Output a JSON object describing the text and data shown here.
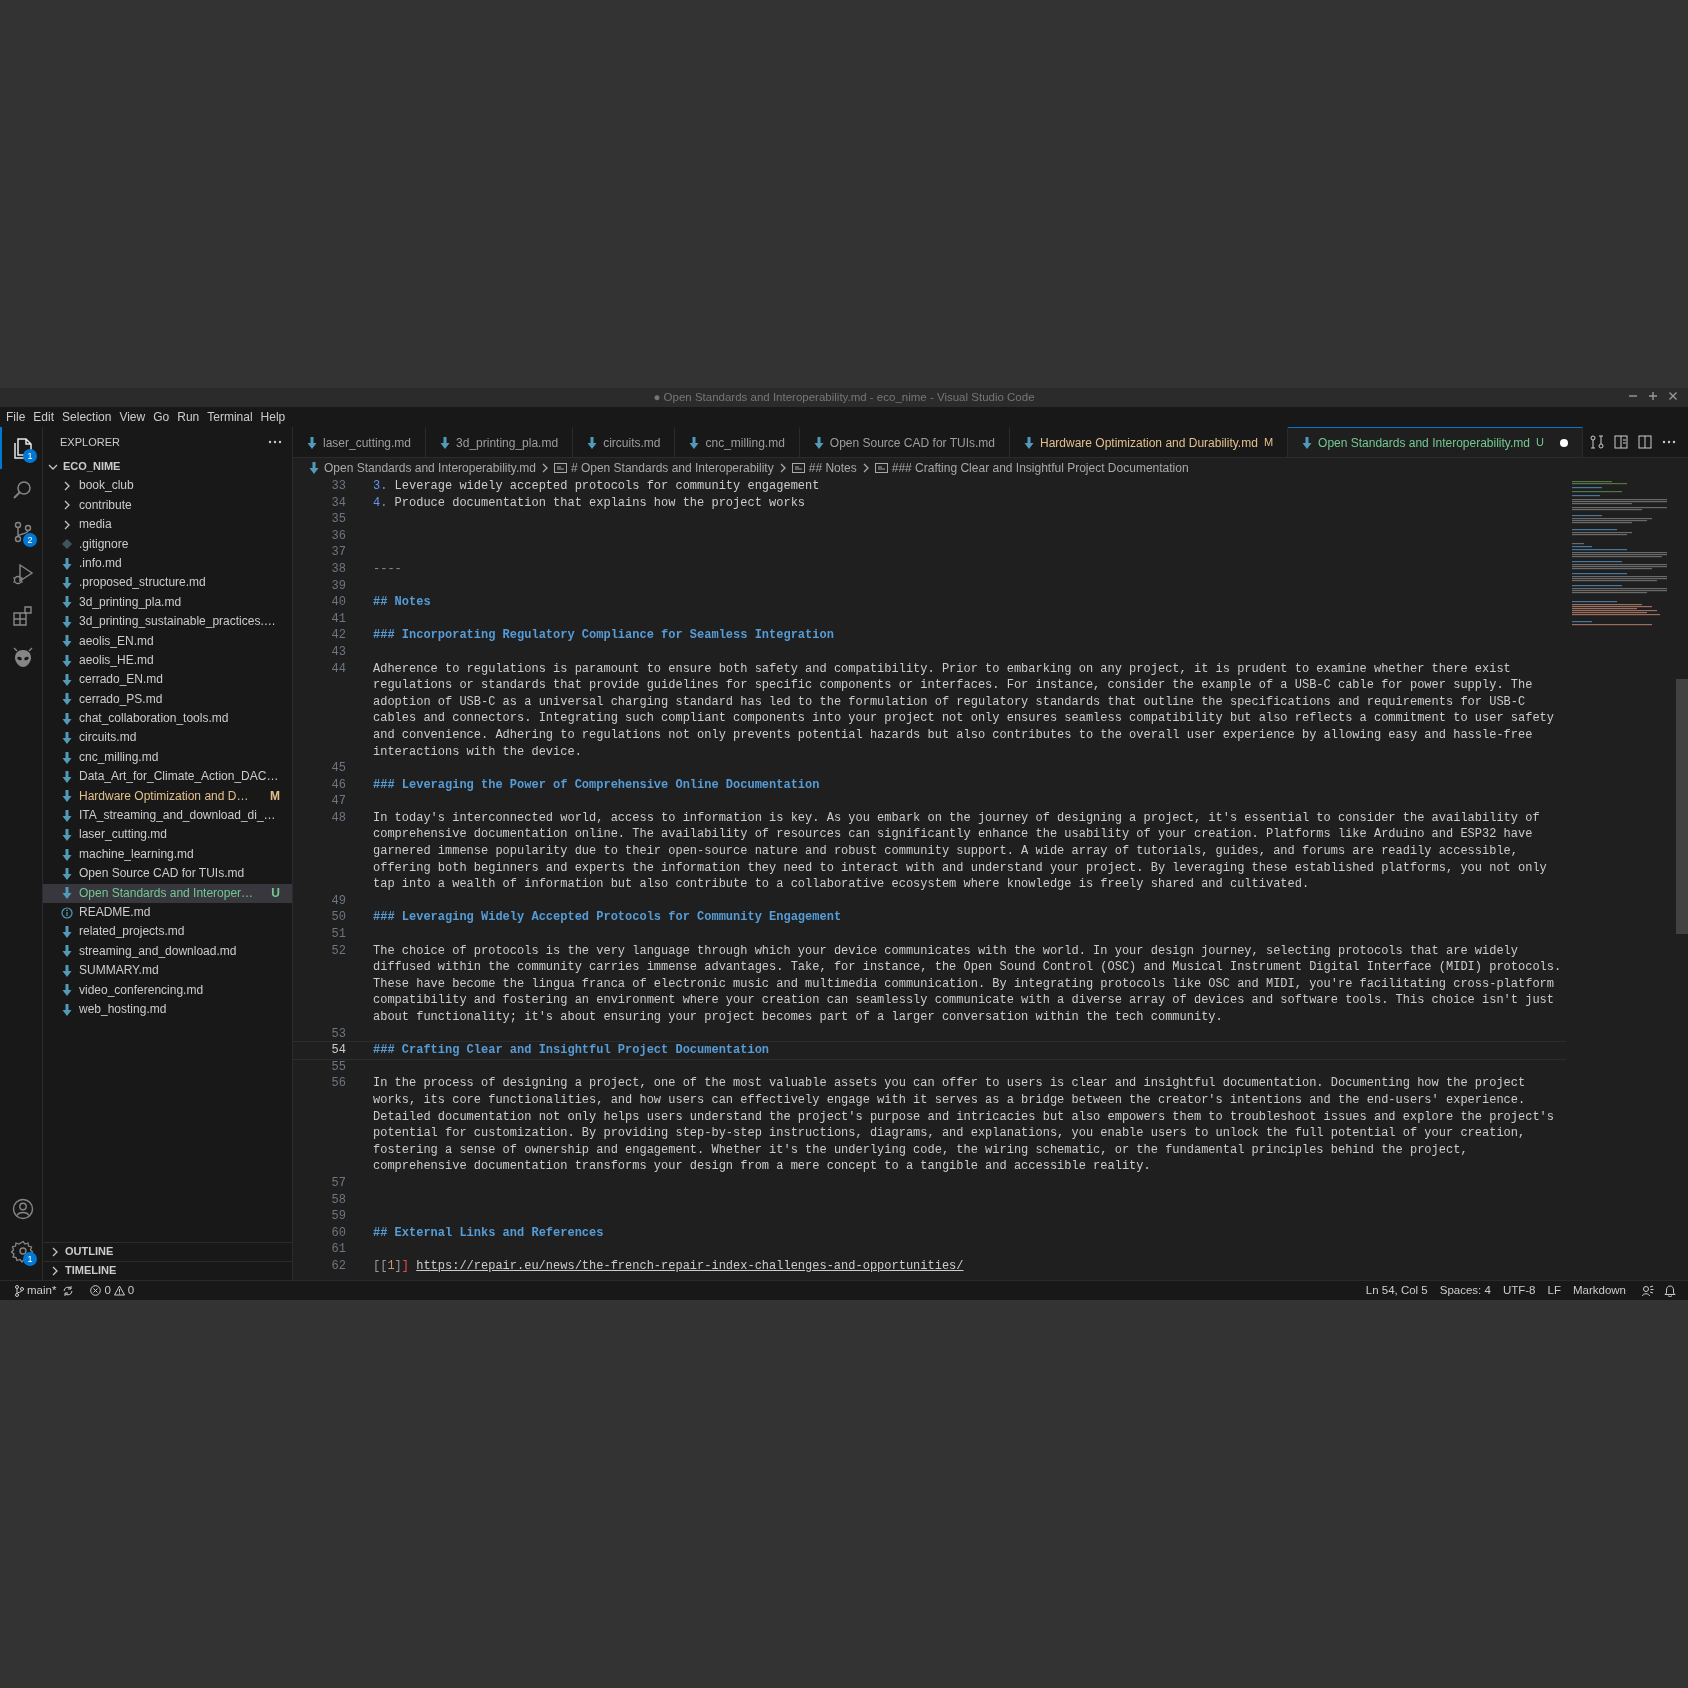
{
  "window": {
    "title": "● Open Standards and Interoperability.md - eco_nime - Visual Studio Code"
  },
  "menu": [
    "File",
    "Edit",
    "Selection",
    "View",
    "Go",
    "Run",
    "Terminal",
    "Help"
  ],
  "activity_bar": [
    {
      "selected": true,
      "badge": "1"
    },
    {
      "selected": false
    },
    {
      "selected": false,
      "badge": "2"
    },
    {
      "selected": false
    },
    {
      "selected": false
    },
    {
      "selected": false
    }
  ],
  "activity_bottom": [
    {
      "selected": false
    },
    {
      "selected": false,
      "badge": "1"
    }
  ],
  "sidebar": {
    "title": "EXPLORER",
    "root": {
      "label": "ECO_NIME",
      "expanded": true
    },
    "items": [
      {
        "label": "book_club",
        "kind": "folder",
        "expanded": false,
        "selected": false
      },
      {
        "label": "contribute",
        "kind": "folder",
        "expanded": false,
        "selected": false
      },
      {
        "label": "media",
        "kind": "folder",
        "expanded": false,
        "selected": false
      },
      {
        "label": ".gitignore",
        "kind": "gitignore",
        "selected": false
      },
      {
        "label": ".info.md",
        "kind": "markdown",
        "selected": false
      },
      {
        "label": ".proposed_structure.md",
        "kind": "markdown",
        "selected": false
      },
      {
        "label": "3d_printing_pla.md",
        "kind": "markdown",
        "selected": false
      },
      {
        "label": "3d_printing_sustainable_practices.…",
        "kind": "markdown",
        "selected": false
      },
      {
        "label": "aeolis_EN.md",
        "kind": "markdown",
        "selected": false
      },
      {
        "label": "aeolis_HE.md",
        "kind": "markdown",
        "selected": false
      },
      {
        "label": "cerrado_EN.md",
        "kind": "markdown",
        "selected": false
      },
      {
        "label": "cerrado_PS.md",
        "kind": "markdown",
        "selected": false
      },
      {
        "label": "chat_collaboration_tools.md",
        "kind": "markdown",
        "selected": false
      },
      {
        "label": "circuits.md",
        "kind": "markdown",
        "selected": false
      },
      {
        "label": "cnc_milling.md",
        "kind": "markdown",
        "selected": false
      },
      {
        "label": "Data_Art_for_Climate_Action_DAC…",
        "kind": "markdown",
        "selected": false
      },
      {
        "label": "Hardware Optimization and D…",
        "kind": "markdown",
        "selected": false,
        "status": "M",
        "color": "#e2c08d"
      },
      {
        "label": "ITA_streaming_and_download_di_…",
        "kind": "markdown",
        "selected": false
      },
      {
        "label": "laser_cutting.md",
        "kind": "markdown",
        "selected": false
      },
      {
        "label": "machine_learning.md",
        "kind": "markdown",
        "selected": false
      },
      {
        "label": "Open Source CAD for TUIs.md",
        "kind": "markdown",
        "selected": false
      },
      {
        "label": "Open Standards and Interoper…",
        "kind": "markdown",
        "selected": true,
        "status": "U",
        "color": "#73c991"
      },
      {
        "label": "README.md",
        "kind": "info",
        "selected": false
      },
      {
        "label": "related_projects.md",
        "kind": "markdown",
        "selected": false
      },
      {
        "label": "streaming_and_download.md",
        "kind": "markdown",
        "selected": false
      },
      {
        "label": "SUMMARY.md",
        "kind": "markdown",
        "selected": false
      },
      {
        "label": "video_conferencing.md",
        "kind": "markdown",
        "selected": false
      },
      {
        "label": "web_hosting.md",
        "kind": "markdown",
        "selected": false
      }
    ],
    "sections": [
      {
        "label": "OUTLINE",
        "expanded": false
      },
      {
        "label": "TIMELINE",
        "expanded": false
      }
    ]
  },
  "tabs": [
    {
      "label": "laser_cutting.md",
      "selected": false,
      "dirty": false
    },
    {
      "label": "3d_printing_pla.md",
      "selected": false,
      "dirty": false
    },
    {
      "label": "circuits.md",
      "selected": false,
      "dirty": false
    },
    {
      "label": "cnc_milling.md",
      "selected": false,
      "dirty": false
    },
    {
      "label": "Open Source CAD for TUIs.md",
      "selected": false,
      "dirty": false
    },
    {
      "label": "Hardware Optimization and Durability.md",
      "selected": false,
      "dirty": false,
      "status": "M",
      "color": "#e2c08d"
    },
    {
      "label": "Open Standards and Interoperability.md",
      "selected": true,
      "dirty": true,
      "status": "U",
      "color": "#73c991"
    }
  ],
  "breadcrumbs": [
    {
      "label": "Open Standards and Interoperability.md",
      "kind": "file"
    },
    {
      "label": "# Open Standards and Interoperability",
      "kind": "symbol"
    },
    {
      "label": "## Notes",
      "kind": "symbol"
    },
    {
      "label": "### Crafting Clear and Insightful Project Documentation",
      "kind": "symbol"
    }
  ],
  "lines": [
    {
      "number": "33",
      "kind": "list",
      "marker": "3.",
      "text": "Leverage widely accepted protocols for community engagement",
      "current": false
    },
    {
      "number": "34",
      "kind": "list",
      "marker": "4.",
      "text": "Produce documentation that explains how the project works",
      "current": false
    },
    {
      "number": "35",
      "current": false
    },
    {
      "number": "36",
      "current": false
    },
    {
      "number": "37",
      "current": false
    },
    {
      "number": "38",
      "kind": "rule",
      "text": "----",
      "current": false
    },
    {
      "number": "39",
      "current": false
    },
    {
      "number": "40",
      "kind": "heading",
      "text": "## Notes",
      "current": false
    },
    {
      "number": "41",
      "current": false
    },
    {
      "number": "42",
      "kind": "heading",
      "text": "### Incorporating Regulatory Compliance for Seamless Integration",
      "current": false
    },
    {
      "number": "43",
      "current": false
    },
    {
      "number": "44",
      "kind": "text",
      "text": "Adherence to regulations is paramount to ensure both safety and compatibility. Prior to embarking on any project, it is prudent to examine whether there exist regulations or standards that provide guidelines for specific components or interfaces. For instance, consider the example of a USB-C cable for power supply. The adoption of USB-C as a universal charging standard has led to the formulation of regulatory standards that outline the specifications and requirements for USB-C cables and connectors. Integrating such compliant components into your project not only ensures seamless compatibility but also reflects a commitment to user safety and convenience. Adhering to regulations not only prevents potential hazards but also contributes to the overall user experience by allowing easy and hassle-free interactions with the device.",
      "current": false
    },
    {
      "number": "45",
      "current": false
    },
    {
      "number": "46",
      "kind": "heading",
      "text": "### Leveraging the Power of Comprehensive Online Documentation",
      "current": false
    },
    {
      "number": "47",
      "current": false
    },
    {
      "number": "48",
      "kind": "text",
      "text": "In today's interconnected world, access to information is key. As you embark on the journey of designing a project, it's essential to consider the availability of comprehensive documentation online. The availability of resources can significantly enhance the usability of your creation. Platforms like Arduino and ESP32 have garnered immense popularity due to their open-source nature and robust community support. A wide array of tutorials, guides, and forums are readily accessible, offering both beginners and experts the information they need to interact with and understand your project. By leveraging these established platforms, you not only tap into a wealth of information but also contribute to a collaborative ecosystem where knowledge is freely shared and cultivated.",
      "current": false
    },
    {
      "number": "49",
      "current": false
    },
    {
      "number": "50",
      "kind": "heading",
      "text": "### Leveraging Widely Accepted Protocols for Community Engagement",
      "current": false
    },
    {
      "number": "51",
      "current": false
    },
    {
      "number": "52",
      "kind": "text",
      "text": "The choice of protocols is the very language through which your device communicates with the world. In your design journey, selecting protocols that are widely diffused within the community carries immense advantages. Take, for instance, the Open Sound Control (OSC) and Musical Instrument Digital Interface (MIDI) protocols. These have become the lingua franca of electronic music and multimedia communication. By integrating protocols like OSC and MIDI, you're facilitating cross-platform compatibility and fostering an environment where your creation can seamlessly communicate with a diverse array of devices and software tools. This choice isn't just about functionality; it's about ensuring your project becomes part of a larger conversation within the tech community.",
      "current": false
    },
    {
      "number": "53",
      "current": false
    },
    {
      "number": "54",
      "kind": "heading",
      "text": "### Crafting Clear and Insightful Project Documentation",
      "current": true
    },
    {
      "number": "55",
      "current": false
    },
    {
      "number": "56",
      "kind": "text",
      "text": "In the process of designing a project, one of the most valuable assets you can offer to users is clear and insightful documentation. Documenting how the project works, its core functionalities, and how users can effectively engage with it serves as a bridge between the creator's intentions and the end-users' experience. Detailed documentation not only helps users understand the project's purpose and intricacies but also empowers them to troubleshoot issues and explore the project's potential for customization. By providing step-by-step instructions, diagrams, and explanations, you enable users to unlock the full potential of your creation, fostering a sense of ownership and engagement. Whether it's the underlying code, the wiring schematic, or the fundamental principles behind the project, comprehensive documentation transforms your design from a mere concept to a tangible and accessible reality.",
      "current": false
    },
    {
      "number": "57",
      "current": false
    },
    {
      "number": "58",
      "current": false
    },
    {
      "number": "59",
      "current": false
    },
    {
      "number": "60",
      "kind": "heading",
      "text": "## External Links and References",
      "current": false
    },
    {
      "number": "61",
      "current": false
    },
    {
      "number": "62",
      "kind": "reference",
      "segments": [
        {
          "kind": "bracket",
          "text": "[["
        },
        {
          "kind": "label",
          "text": "1"
        },
        {
          "kind": "bracket",
          "text": "]"
        },
        {
          "kind": "close",
          "text": "]"
        }
      ],
      "url": "https://repair.eu/news/the-french-repair-index-challenges-and-opportunities/",
      "current": false
    }
  ],
  "status_bar": {
    "branch": "main*",
    "errors": "0",
    "warnings": "0",
    "right": [
      "Ln 54, Col 5",
      "Spaces: 4",
      "UTF-8",
      "LF",
      "Markdown"
    ]
  }
}
